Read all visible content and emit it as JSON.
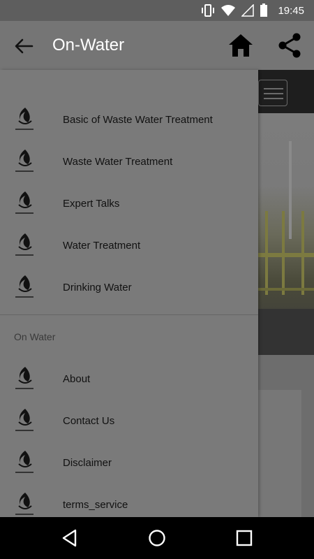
{
  "status_bar": {
    "time": "19:45",
    "icons": [
      "vibrate-icon",
      "wifi-icon",
      "signal-icon",
      "battery-icon"
    ]
  },
  "app_bar": {
    "title": "On-Water",
    "icons": [
      "back-arrow-icon",
      "home-icon",
      "share-icon"
    ]
  },
  "drawer": {
    "items": [
      {
        "label": "Basic of Waste Water Treatment",
        "icon": "on-water-logo-icon"
      },
      {
        "label": "Waste Water Treatment",
        "icon": "on-water-logo-icon"
      },
      {
        "label": "Expert Talks",
        "icon": "on-water-logo-icon"
      },
      {
        "label": "Water Treatment",
        "icon": "on-water-logo-icon"
      },
      {
        "label": "Drinking Water",
        "icon": "on-water-logo-icon"
      }
    ],
    "section_title": "On Water",
    "section_items": [
      {
        "label": "About",
        "icon": "on-water-logo-icon"
      },
      {
        "label": "Contact Us",
        "icon": "on-water-logo-icon"
      },
      {
        "label": "Disclaimer",
        "icon": "on-water-logo-icon"
      },
      {
        "label": "terms_service",
        "icon": "on-water-logo-icon"
      }
    ]
  },
  "nav_bar": {
    "icons": [
      "back-triangle-icon",
      "home-circle-icon",
      "recents-square-icon"
    ]
  },
  "colors": {
    "scrim_background": "#7a7a7a",
    "app_bar": "#757575",
    "status_bar": "#5e5e5e",
    "nav_bar": "#000000",
    "item_text": "#111111"
  }
}
